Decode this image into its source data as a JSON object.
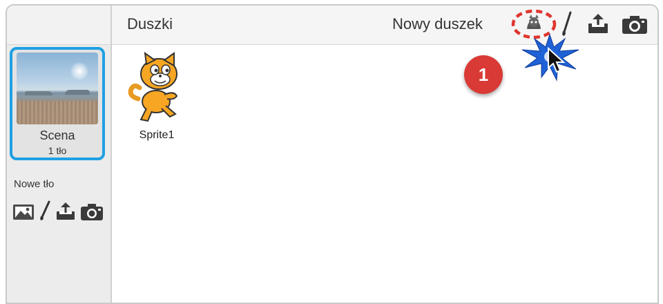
{
  "sprites_panel": {
    "title": "Duszki",
    "new_sprite_label": "Nowy duszek",
    "tools": [
      "sprite-library-icon",
      "paintbrush-icon",
      "upload-icon",
      "camera-icon"
    ]
  },
  "stage": {
    "name": "Scena",
    "backdrop_count": "1 tło"
  },
  "new_backdrop": {
    "label": "Nowe tło",
    "tools": [
      "image-library-icon",
      "paintbrush-icon",
      "upload-icon",
      "camera-icon"
    ]
  },
  "sprites": [
    {
      "name": "Sprite1"
    }
  ],
  "annotation": {
    "step_number": "1",
    "highlight_color": "#e0362f",
    "selection_color": "#1fa0e3"
  }
}
